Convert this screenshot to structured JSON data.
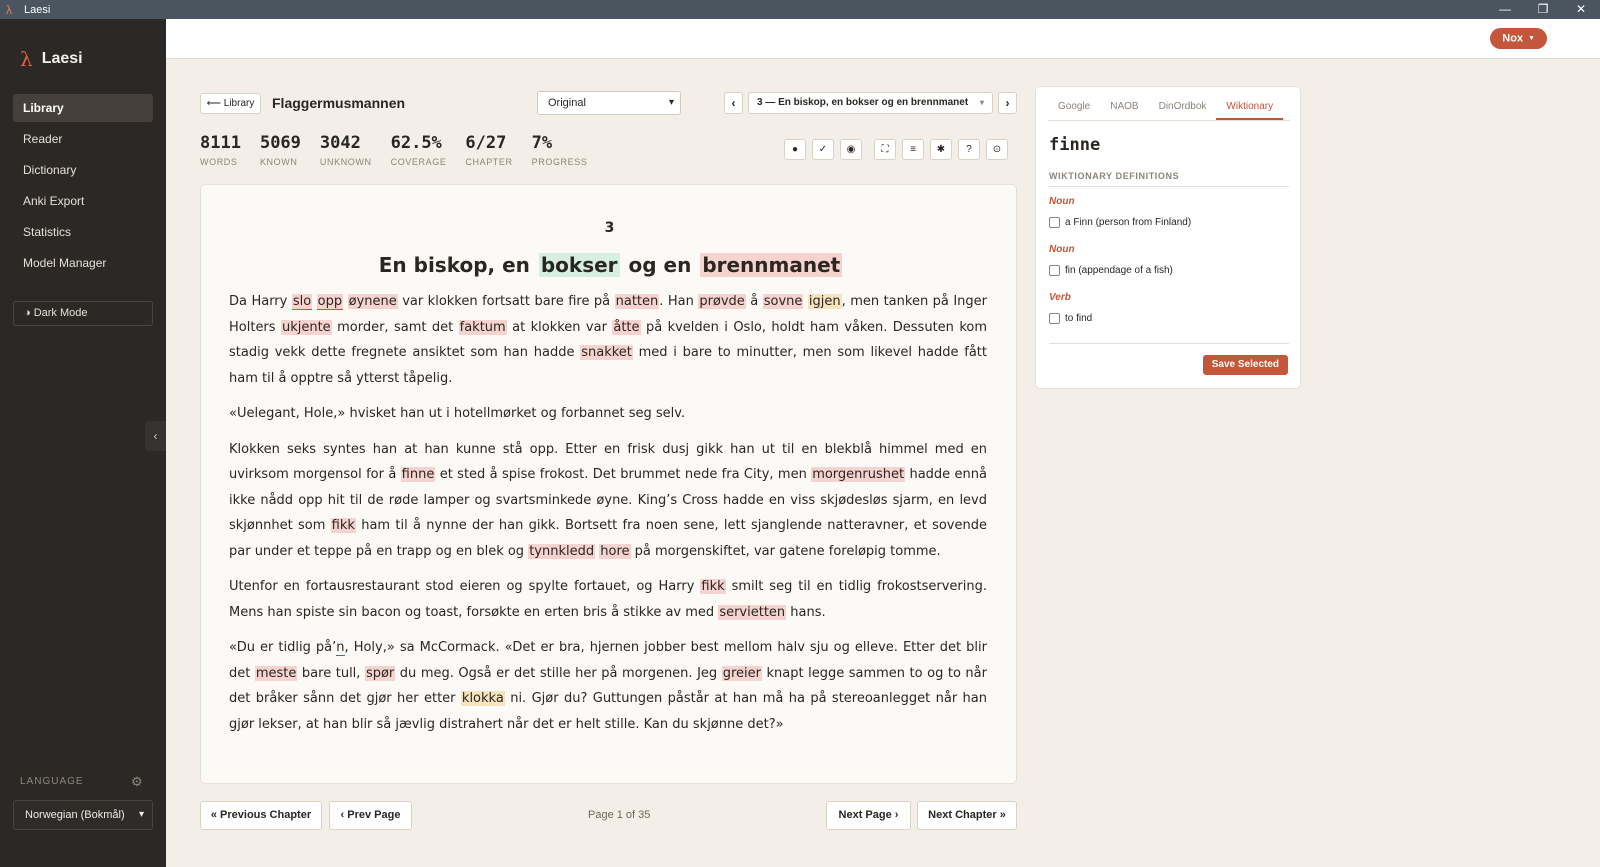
{
  "window": {
    "title": "Laesi",
    "controls": [
      "—",
      "❐",
      "✕"
    ]
  },
  "sidebar": {
    "brand": "Laesi",
    "nav": [
      {
        "label": "Library",
        "active": true
      },
      {
        "label": "Reader"
      },
      {
        "label": "Dictionary"
      },
      {
        "label": "Anki Export"
      },
      {
        "label": "Statistics"
      },
      {
        "label": "Model Manager"
      }
    ],
    "dark_mode_label": "◑ Dark Mode",
    "collapse_glyph": "‹",
    "language_label": "LANGUAGE",
    "language_value": "Norwegian (Bokmål)"
  },
  "topbar": {
    "user": "Nox"
  },
  "header": {
    "back_label": "⟵ Library",
    "book_title": "Flaggermusmannen",
    "mode_value": "Original",
    "chapter_value": "3 — En biskop, en bokser og en brennmanet",
    "prev_glyph": "‹",
    "next_glyph": "›"
  },
  "stats": [
    {
      "value": "8111",
      "label": "WORDS"
    },
    {
      "value": "5069",
      "label": "KNOWN"
    },
    {
      "value": "3042",
      "label": "UNKNOWN"
    },
    {
      "value": "62.5%",
      "label": "COVERAGE"
    },
    {
      "value": "6/27",
      "label": "CHAPTER"
    },
    {
      "value": "7%",
      "label": "PROGRESS"
    }
  ],
  "toolbar": [
    "●",
    "✓",
    "◉",
    "⛶",
    "≡",
    "✱",
    "?",
    "⊙"
  ],
  "reader": {
    "chapter_number": "3",
    "chapter_title_parts": [
      "En biskop, en ",
      "bokser",
      " og en ",
      "brennmanet"
    ]
  },
  "pagination": {
    "prev_chapter": "« Previous Chapter",
    "prev_page": "‹ Prev Page",
    "info": "Page 1 of 35",
    "next_page": "Next Page ›",
    "next_chapter": "Next Chapter »"
  },
  "dictionary": {
    "tabs": [
      "Google",
      "NAOB",
      "DinOrdbok",
      "Wiktionary"
    ],
    "active_tab": "Wiktionary",
    "word": "finne",
    "subheading": "WIKTIONARY DEFINITIONS",
    "definitions": [
      {
        "pos": "Noun",
        "text": "a Finn (person from Finland)"
      },
      {
        "pos": "Noun",
        "text": "fin (appendage of a fish)"
      },
      {
        "pos": "Verb",
        "text": "to find"
      }
    ],
    "save_label": "Save Selected"
  }
}
